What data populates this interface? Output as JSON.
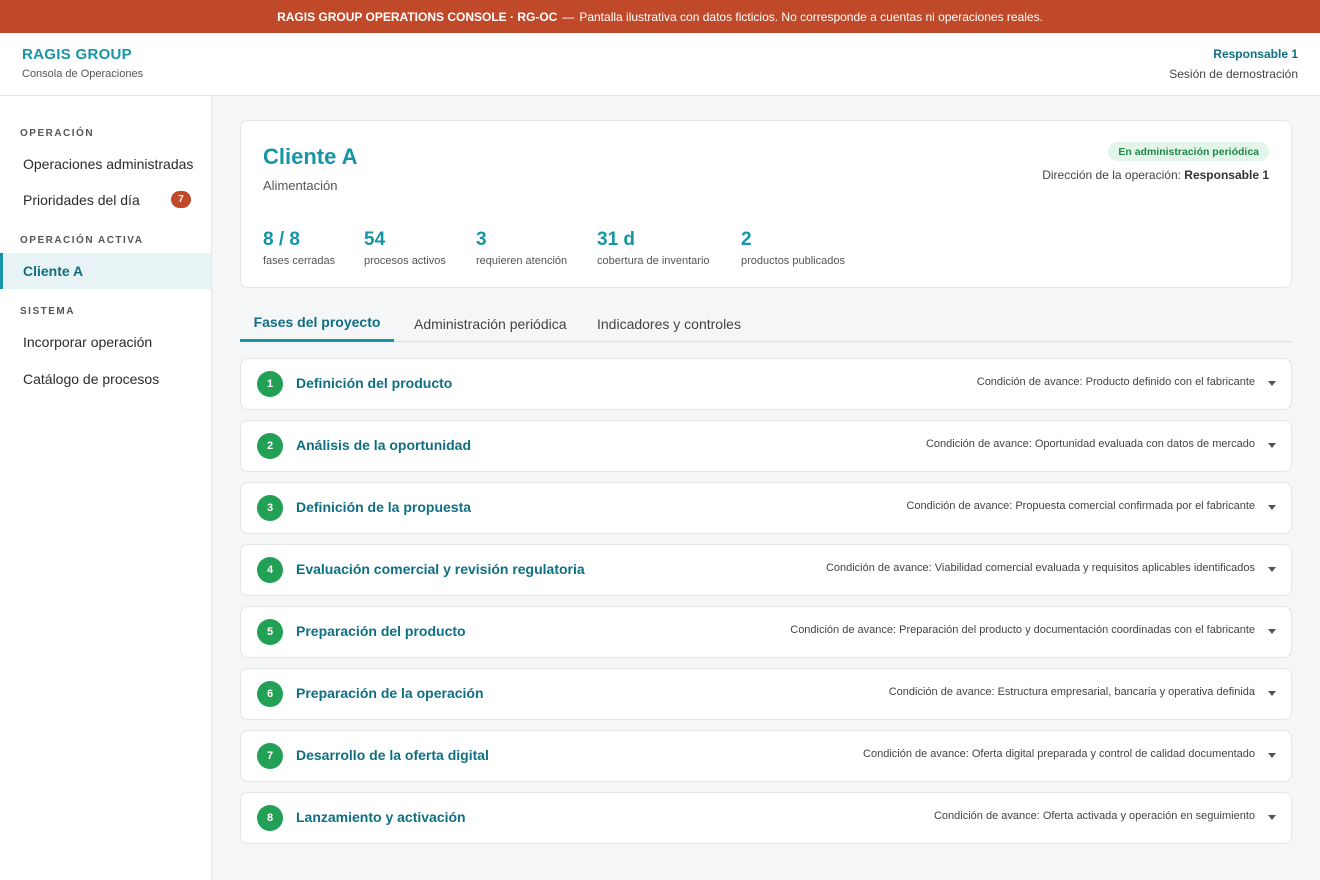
{
  "banner": {
    "title": "RAGIS GROUP OPERATIONS CONSOLE · RG-OC",
    "separator": "—",
    "note": "Pantalla ilustrativa con datos ficticios. No corresponde a cuentas ni operaciones reales."
  },
  "header": {
    "brand": "RAGIS GROUP",
    "subtitle": "Consola de Operaciones",
    "user_name": "Responsable 1",
    "session": "Sesión de demostración"
  },
  "sidebar": {
    "section_operation": "OPERACIÓN",
    "items_operation": [
      {
        "label": "Operaciones administradas"
      },
      {
        "label": "Prioridades del día",
        "badge": "7"
      }
    ],
    "section_active": "OPERACIÓN ACTIVA",
    "active_item": "Cliente A",
    "section_system": "SISTEMA",
    "items_system": [
      {
        "label": "Incorporar operación"
      },
      {
        "label": "Catálogo de procesos"
      }
    ]
  },
  "client": {
    "name": "Cliente A",
    "sector": "Alimentación",
    "status": "En administración periódica",
    "direction_label": "Dirección de la operación:",
    "direction_value": "Responsable 1",
    "stats": [
      {
        "value": "8 / 8",
        "label": "fases cerradas"
      },
      {
        "value": "54",
        "label": "procesos activos"
      },
      {
        "value": "3",
        "label": "requieren atención"
      },
      {
        "value": "31 d",
        "label": "cobertura de inventario"
      },
      {
        "value": "2",
        "label": "productos publicados"
      }
    ]
  },
  "tabs": [
    {
      "label": "Fases del proyecto",
      "active": true
    },
    {
      "label": "Administración periódica",
      "active": false
    },
    {
      "label": "Indicadores y controles",
      "active": false
    }
  ],
  "phases": [
    {
      "num": "1",
      "title": "Definición del producto",
      "condition": "Condición de avance: Producto definido con el fabricante"
    },
    {
      "num": "2",
      "title": "Análisis de la oportunidad",
      "condition": "Condición de avance: Oportunidad evaluada con datos de mercado"
    },
    {
      "num": "3",
      "title": "Definición de la propuesta",
      "condition": "Condición de avance: Propuesta comercial confirmada por el fabricante"
    },
    {
      "num": "4",
      "title": "Evaluación comercial y revisión regulatoria",
      "condition": "Condición de avance: Viabilidad comercial evaluada y requisitos aplicables identificados"
    },
    {
      "num": "5",
      "title": "Preparación del producto",
      "condition": "Condición de avance: Preparación del producto y documentación coordinadas con el fabricante"
    },
    {
      "num": "6",
      "title": "Preparación de la operación",
      "condition": "Condición de avance: Estructura empresarial, bancaria y operativa definida"
    },
    {
      "num": "7",
      "title": "Desarrollo de la oferta digital",
      "condition": "Condición de avance: Oferta digital preparada y control de calidad documentado"
    },
    {
      "num": "8",
      "title": "Lanzamiento y activación",
      "condition": "Condición de avance: Oferta activada y operación en seguimiento"
    }
  ],
  "colors": {
    "banner": "#c0492a",
    "accent": "#1795a6",
    "accent_dark": "#0f6f82",
    "phase_done": "#22a056",
    "status_bg": "#e2f5e8",
    "status_text": "#22884a",
    "badge": "#c0492a"
  },
  "icons": {
    "phase_toggle": "chevron-down-icon",
    "phase_status": "phase-number-circle"
  }
}
